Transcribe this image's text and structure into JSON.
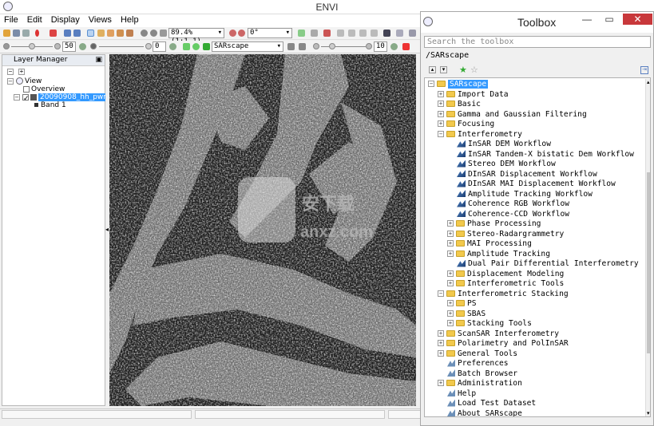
{
  "envi": {
    "title": "ENVI",
    "menu": [
      "File",
      "Edit",
      "Display",
      "Views",
      "Help"
    ],
    "zoom": "89.4% (1:1.1)",
    "rotation": "0°",
    "brightness": "50",
    "contrast": "0",
    "sharpen": "10",
    "layer_dropdown": "SARscape",
    "layer_manager": {
      "title": "Layer Manager",
      "items": [
        "View",
        "Overview",
        "20090908_hh_pwr",
        "Band 1"
      ]
    },
    "watermark": {
      "text": "安下载",
      "sub": "anxz.com"
    }
  },
  "toolbox": {
    "title": "Toolbox",
    "search_placeholder": "Search the toolbox",
    "path": "/SARscape",
    "tree": [
      {
        "label": "SARscape",
        "depth": 0,
        "type": "folder",
        "expander": "−",
        "selected": true
      },
      {
        "label": "Import Data",
        "depth": 1,
        "type": "folder",
        "expander": "+"
      },
      {
        "label": "Basic",
        "depth": 1,
        "type": "folder",
        "expander": "+"
      },
      {
        "label": "Gamma and Gaussian Filtering",
        "depth": 1,
        "type": "folder",
        "expander": "+"
      },
      {
        "label": "Focusing",
        "depth": 1,
        "type": "folder",
        "expander": "+"
      },
      {
        "label": "Interferometry",
        "depth": 1,
        "type": "folder",
        "expander": "−"
      },
      {
        "label": "InSAR DEM Workflow",
        "depth": 2,
        "type": "workflow"
      },
      {
        "label": "InSAR Tandem-X bistatic Dem Workflow",
        "depth": 2,
        "type": "workflow"
      },
      {
        "label": "Stereo DEM Workflow",
        "depth": 2,
        "type": "workflow"
      },
      {
        "label": "DInSAR Displacement Workflow",
        "depth": 2,
        "type": "workflow"
      },
      {
        "label": "DInSAR MAI Displacement Workflow",
        "depth": 2,
        "type": "workflow"
      },
      {
        "label": "Amplitude Tracking Workflow",
        "depth": 2,
        "type": "workflow"
      },
      {
        "label": "Coherence RGB Workflow",
        "depth": 2,
        "type": "workflow"
      },
      {
        "label": "Coherence-CCD Workflow",
        "depth": 2,
        "type": "workflow"
      },
      {
        "label": "Phase Processing",
        "depth": 2,
        "type": "folder",
        "expander": "+"
      },
      {
        "label": "Stereo-Radargrammetry",
        "depth": 2,
        "type": "folder",
        "expander": "+"
      },
      {
        "label": "MAI Processing",
        "depth": 2,
        "type": "folder",
        "expander": "+"
      },
      {
        "label": "Amplitude Tracking",
        "depth": 2,
        "type": "folder",
        "expander": "+"
      },
      {
        "label": "Dual Pair Differential Interferometry",
        "depth": 2,
        "type": "workflow"
      },
      {
        "label": "Displacement Modeling",
        "depth": 2,
        "type": "folder",
        "expander": "+"
      },
      {
        "label": "Interferometric Tools",
        "depth": 2,
        "type": "folder",
        "expander": "+"
      },
      {
        "label": "Interferometric Stacking",
        "depth": 1,
        "type": "folder",
        "expander": "−"
      },
      {
        "label": "PS",
        "depth": 2,
        "type": "folder",
        "expander": "+"
      },
      {
        "label": "SBAS",
        "depth": 2,
        "type": "folder",
        "expander": "+"
      },
      {
        "label": "Stacking Tools",
        "depth": 2,
        "type": "folder",
        "expander": "+"
      },
      {
        "label": "ScanSAR Interferometry",
        "depth": 1,
        "type": "folder",
        "expander": "+"
      },
      {
        "label": "Polarimetry and PolInSAR",
        "depth": 1,
        "type": "folder",
        "expander": "+"
      },
      {
        "label": "General Tools",
        "depth": 1,
        "type": "folder",
        "expander": "+"
      },
      {
        "label": "Preferences",
        "depth": 1,
        "type": "leaf"
      },
      {
        "label": "Batch Browser",
        "depth": 1,
        "type": "leaf"
      },
      {
        "label": "Administration",
        "depth": 1,
        "type": "folder",
        "expander": "+"
      },
      {
        "label": "Help",
        "depth": 1,
        "type": "leaf"
      },
      {
        "label": "Load Test Dataset",
        "depth": 1,
        "type": "leaf"
      },
      {
        "label": "About SARscape",
        "depth": 1,
        "type": "leaf"
      }
    ]
  }
}
